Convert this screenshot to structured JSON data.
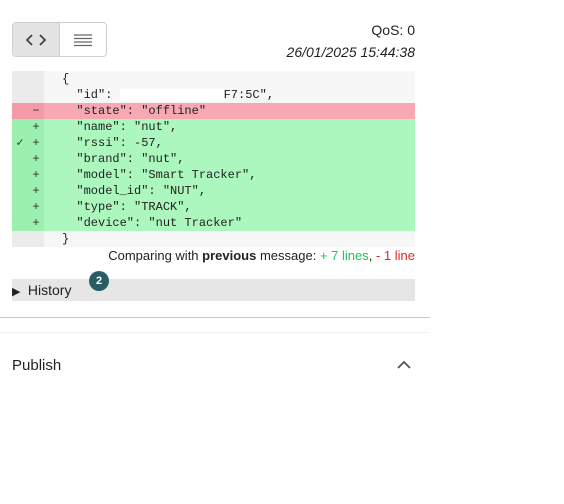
{
  "toolbar": {
    "code_view_icon": "code-brackets-icon",
    "list_view_icon": "lines-list-icon"
  },
  "message": {
    "qos_text": "QoS: 0",
    "timestamp": "26/01/2025 15:44:38"
  },
  "diff": {
    "lines": [
      {
        "type": "ctx",
        "g1": "",
        "g2": "",
        "code": "{"
      },
      {
        "type": "ctx",
        "g1": "",
        "g2": "",
        "code_prefix": "  \"id\": ",
        "code_suffix": "F7:5C\",",
        "masked": true
      },
      {
        "type": "del",
        "g1": "",
        "g2": "−",
        "code": "  \"state\": \"offline\""
      },
      {
        "type": "add",
        "g1": "",
        "g2": "+",
        "code": "  \"name\": \"nut\","
      },
      {
        "type": "add",
        "g1": "✓",
        "g2": "+",
        "code": "  \"rssi\": -57,"
      },
      {
        "type": "add",
        "g1": "",
        "g2": "+",
        "code": "  \"brand\": \"nut\","
      },
      {
        "type": "add",
        "g1": "",
        "g2": "+",
        "code": "  \"model\": \"Smart Tracker\","
      },
      {
        "type": "add",
        "g1": "",
        "g2": "+",
        "code": "  \"model_id\": \"NUT\","
      },
      {
        "type": "add",
        "g1": "",
        "g2": "+",
        "code": "  \"type\": \"TRACK\","
      },
      {
        "type": "add",
        "g1": "",
        "g2": "+",
        "code": "  \"device\": \"nut Tracker\""
      },
      {
        "type": "ctx",
        "g1": "",
        "g2": "",
        "code": "}"
      }
    ]
  },
  "comparison": {
    "prefix": "Comparing with ",
    "bold": "previous",
    "middle": " message: ",
    "added": "+ 7 lines",
    "sep": ", ",
    "removed": "- 1 line"
  },
  "history": {
    "label": "History",
    "badge_count": "2"
  },
  "publish": {
    "label": "Publish",
    "chevron_icon": "chevron-up-icon"
  },
  "colors": {
    "added_bg": "#abf7bd",
    "removed_bg": "#f7a8b3",
    "badge": "#2b5c66",
    "added_text": "#22c55e",
    "removed_text": "#dc2626"
  }
}
